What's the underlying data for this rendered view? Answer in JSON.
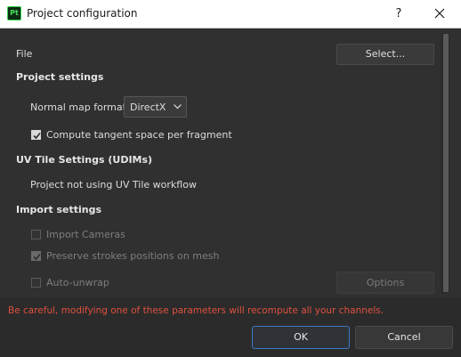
{
  "window": {
    "app_icon_text": "Pt",
    "title": "Project configuration",
    "help_glyph": "?",
    "close_icon": "close-icon"
  },
  "file": {
    "label": "File",
    "select_button": "Select..."
  },
  "project_settings": {
    "header": "Project settings",
    "normal_map_label": "Normal map format",
    "normal_map_value": "DirectX",
    "compute_tangent_label": "Compute tangent space per fragment",
    "compute_tangent_checked": true
  },
  "uv_tile": {
    "header": "UV Tile Settings (UDIMs)",
    "status": "Project not using UV Tile workflow"
  },
  "import_settings": {
    "header": "Import settings",
    "import_cameras_label": "Import Cameras",
    "import_cameras_checked": false,
    "preserve_strokes_label": "Preserve strokes positions on mesh",
    "preserve_strokes_checked": true,
    "auto_unwrap_label": "Auto-unwrap",
    "auto_unwrap_checked": false,
    "options_button": "Options"
  },
  "warning": "Be careful, modifying one of these parameters will recompute all your channels.",
  "footer": {
    "ok": "OK",
    "cancel": "Cancel"
  },
  "colors": {
    "accent_border": "#3d78c4",
    "warning": "#e0503e",
    "brand_green": "#35d24a"
  }
}
